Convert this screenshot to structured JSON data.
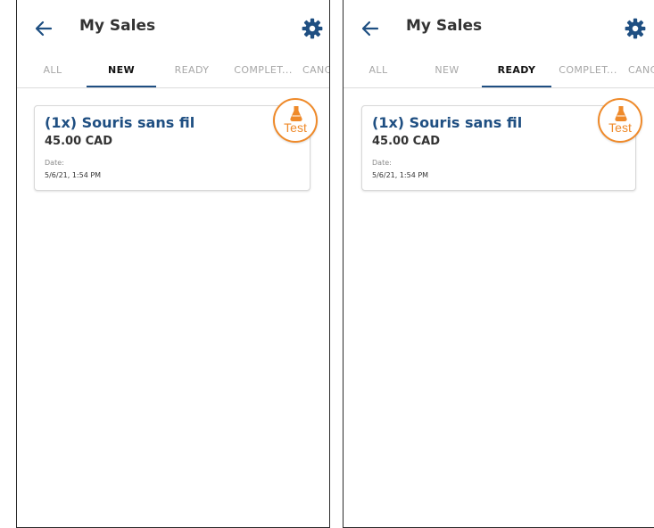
{
  "screens": [
    {
      "title": "My Sales",
      "tabs": [
        "ALL",
        "NEW",
        "READY",
        "COMPLET...",
        "CANCELLED"
      ],
      "active_tab": "NEW",
      "sale": {
        "item": "(1x) Souris sans fil",
        "price": "45.00 CAD",
        "date_label": "Date:",
        "date": "5/6/21, 1:54 PM",
        "badge": "Test"
      }
    },
    {
      "title": "My Sales",
      "tabs": [
        "ALL",
        "NEW",
        "READY",
        "COMPLET...",
        "CANCELLED"
      ],
      "active_tab": "READY",
      "sale": {
        "item": "(1x) Souris sans fil",
        "price": "45.00 CAD",
        "date_label": "Date:",
        "date": "5/6/21, 1:54 PM",
        "badge": "Test"
      }
    }
  ],
  "colors": {
    "brand_blue": "#1f4f82",
    "badge_orange": "#ef8a2a",
    "tab_inactive": "#a7a7a7"
  },
  "icons": [
    "back-arrow-icon",
    "settings-gear-icon",
    "flask-icon"
  ]
}
